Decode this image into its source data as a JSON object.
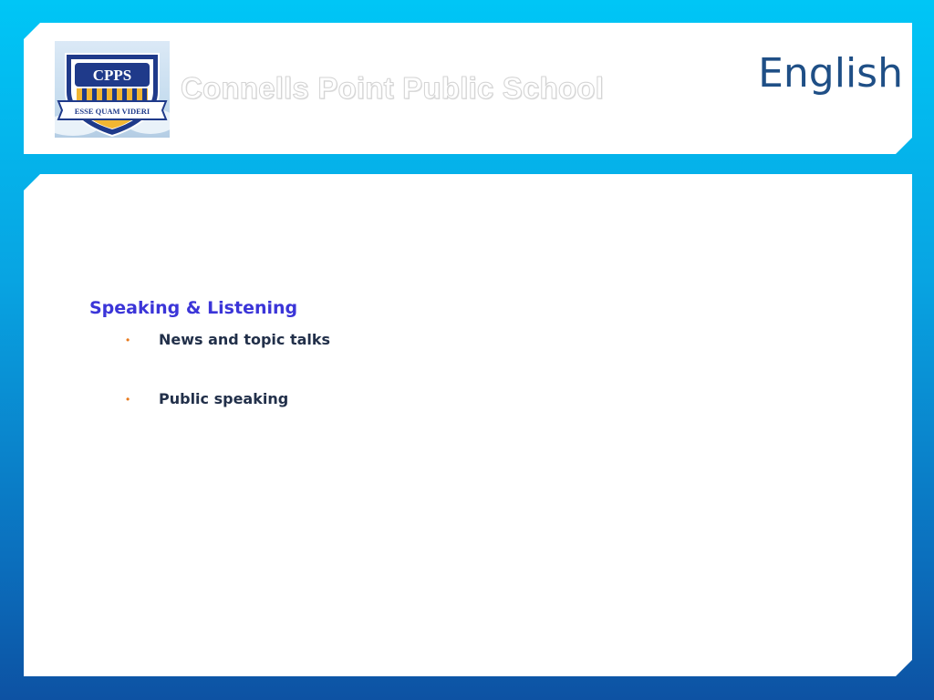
{
  "header": {
    "school_name": "Connells Point Public School",
    "subject_title": "English",
    "logo": {
      "initials": "CPPS",
      "motto": "ESSE QUAM VIDERI"
    }
  },
  "content": {
    "section_heading": "Speaking & Listening",
    "bullet_symbol": "•",
    "items": [
      {
        "label": "News and topic talks"
      },
      {
        "label": "Public speaking"
      }
    ]
  },
  "colors": {
    "background_top": "#00c6f6",
    "background_bottom": "#0d52a3",
    "title_blue": "#1f4f86",
    "heading_purple": "#3b35d8",
    "bullet_orange": "#e87a1d",
    "logo_navy": "#1f3a8a",
    "logo_gold": "#f2b632"
  }
}
